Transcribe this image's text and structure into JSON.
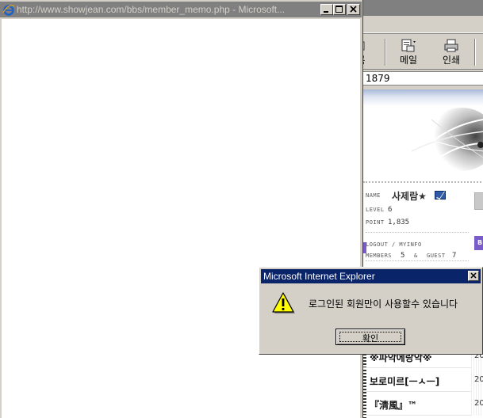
{
  "popup": {
    "title": "http://www.showjean.com/bbs/member_memo.php - Microsoft..."
  },
  "background_window": {
    "toolbar": {
      "partial_label": "록",
      "mail_label": "메일",
      "print_label": "인쇄"
    },
    "address_fragment": "1879",
    "member_panel": {
      "name_key": "NAME",
      "name_value": "사제람★",
      "level_key": "LEVEL",
      "level_value": "6",
      "point_key": "POINT",
      "point_value": "1,835",
      "logout_link": "LOGOUT / MYINFO",
      "members_key": "MEMBERS",
      "members_value": "5",
      "amp": "&",
      "guest_key": "GUEST",
      "guest_value": "7",
      "badge_text": "B"
    },
    "list": [
      {
        "title": "※파악에랑악※",
        "date": "20"
      },
      {
        "title": "보로미르[ㅡㅅㅡ]",
        "date": "20"
      },
      {
        "title": "『淸風』™",
        "date": "20"
      }
    ]
  },
  "dialog": {
    "title": "Microsoft Internet Explorer",
    "icon": "warning-icon",
    "message": "로그인된 회원만이 사용할수 있습니다",
    "ok_label": "확인"
  },
  "colors": {
    "dialog_titlebar": "#0a246a",
    "inactive_titlebar": "#808080",
    "window_face": "#d4d0c8"
  }
}
